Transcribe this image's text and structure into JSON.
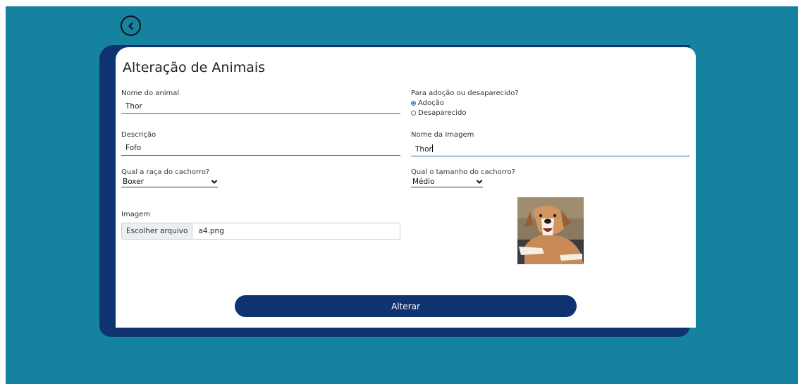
{
  "page": {
    "title": "Alteração de Animais",
    "back_icon": "chevron-left-circle-icon"
  },
  "form": {
    "name": {
      "label": "Nome do animal",
      "value": "Thor"
    },
    "description": {
      "label": "Descrição",
      "value": "Fofo"
    },
    "breed": {
      "label": "Qual a raça do cachorro?",
      "selected": "Boxer"
    },
    "purpose": {
      "label": "Para adoção ou desaparecido?",
      "options": [
        "Adoção",
        "Desaparecido"
      ],
      "selected": "Adoção"
    },
    "image_name": {
      "label": "Nome da Imagem",
      "value": "Thor"
    },
    "size": {
      "label": "Qual o tamanho do cachorro?",
      "selected": "Médio"
    },
    "image": {
      "label": "Imagem",
      "button": "Escolher arquivo",
      "file_name": "a4.png"
    },
    "submit_label": "Alterar"
  },
  "colors": {
    "background": "#1582a0",
    "navy": "#0f3370",
    "card": "#ffffff"
  }
}
